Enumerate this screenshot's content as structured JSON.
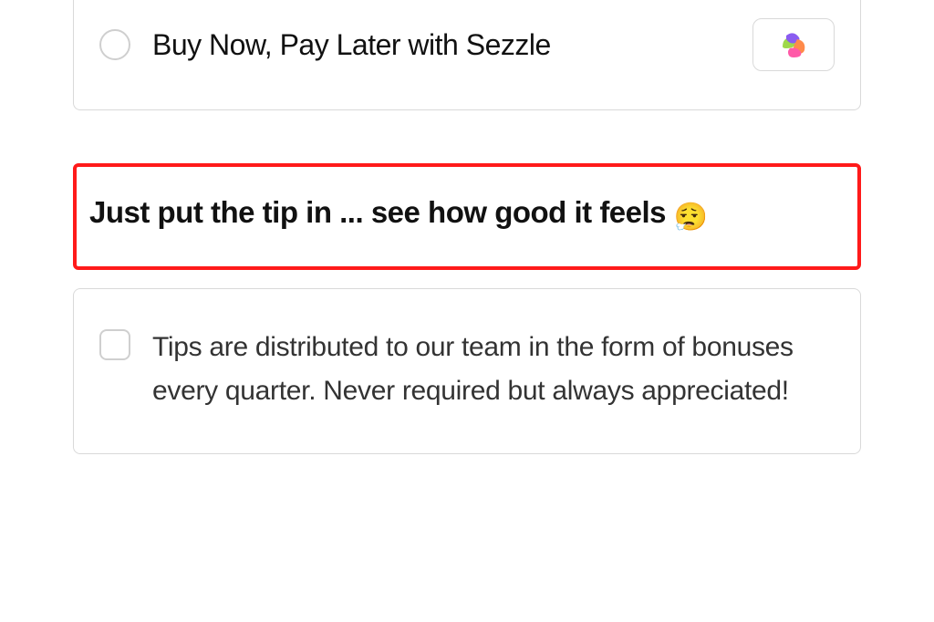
{
  "payment_option": {
    "label": "Buy Now, Pay Later with Sezzle",
    "brand_icon": "sezzle-icon"
  },
  "highlight": {
    "text": "Just put the tip in ... see how good it feels",
    "emoji": "😮‍💨"
  },
  "tips": {
    "description": "Tips are distributed to our team in the form of bonuses every quarter. Never required but always appreciated!"
  }
}
